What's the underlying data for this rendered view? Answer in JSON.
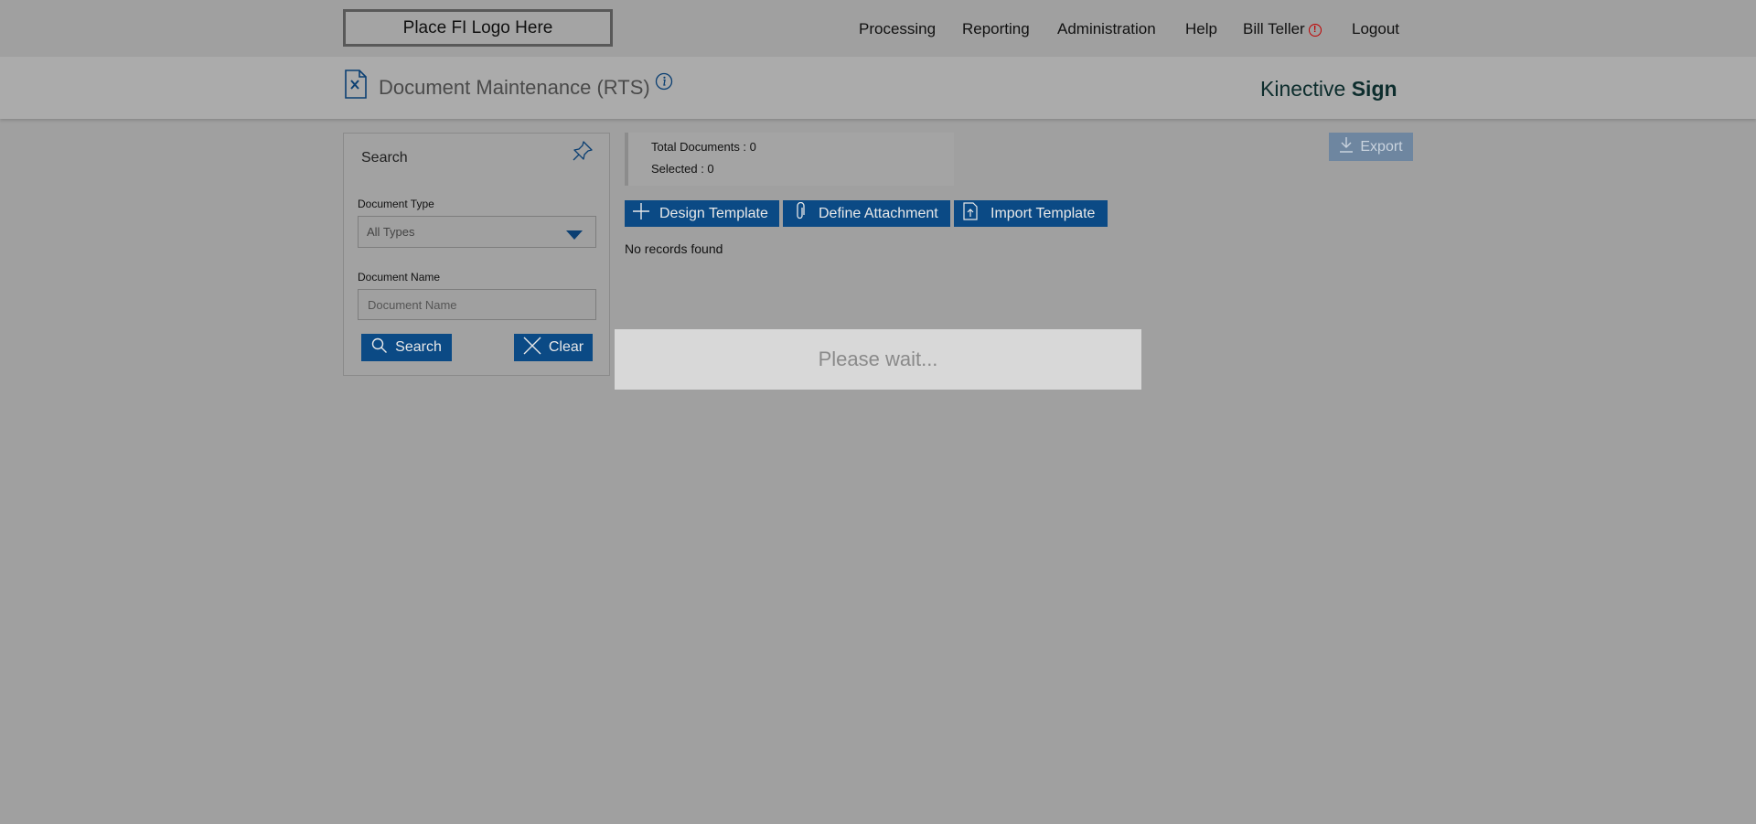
{
  "header": {
    "logo_text": "Place FI Logo Here",
    "nav": [
      "Processing",
      "Reporting",
      "Administration",
      "Help"
    ],
    "user_name": "Bill Teller",
    "logout_label": "Logout"
  },
  "page": {
    "title": "Document Maintenance (RTS)",
    "brand_light": "Kinective ",
    "brand_bold": "Sign"
  },
  "search": {
    "title": "Search",
    "doc_type_label": "Document Type",
    "doc_type_value": "All Types",
    "doc_name_label": "Document Name",
    "doc_name_placeholder": "Document Name",
    "search_button": "Search",
    "clear_button": "Clear"
  },
  "summary": {
    "total_label": "Total Documents : 0",
    "selected_label": "Selected : 0"
  },
  "actions": {
    "design_template": "Design Template",
    "define_attachment": "Define Attachment",
    "import_template": "Import Template",
    "export": "Export"
  },
  "results": {
    "empty_message": "No records found"
  },
  "overlay": {
    "message": "Please wait..."
  },
  "colors": {
    "primary_button": "#0b4a85",
    "overlay_backdrop": "#a0a0a0",
    "alert": "#c00000"
  }
}
